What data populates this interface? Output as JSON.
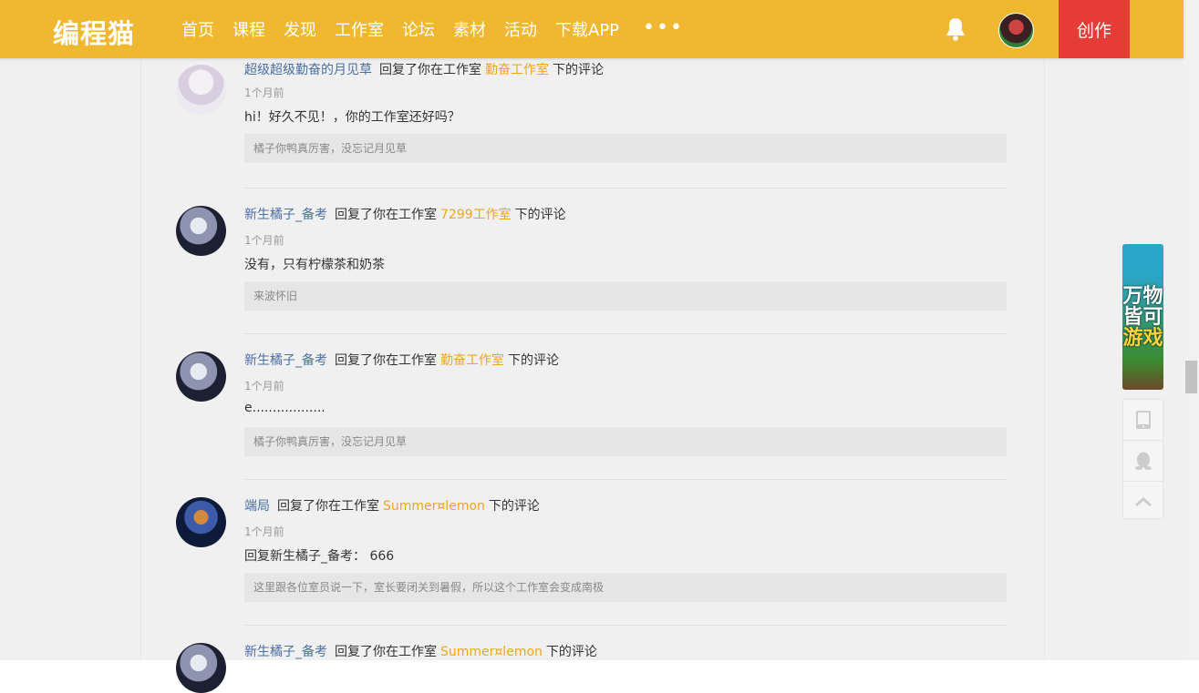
{
  "header": {
    "logo": "编程猫",
    "nav": [
      "首页",
      "课程",
      "发现",
      "工作室",
      "论坛",
      "素材",
      "活动",
      "下载APP"
    ],
    "more": "•••",
    "create_label": "创作"
  },
  "comments": [
    {
      "user": "超级超级勤奋的月见草",
      "action": "回复了你在工作室",
      "studio": "勤奋工作室",
      "suffix": "下的评论",
      "time": "1个月前",
      "text": "hi！好久不见！，你的工作室还好吗？",
      "quote": "橘子你鸭真厉害，没忘记月见草"
    },
    {
      "user": "新生橘子_备考",
      "action": "回复了你在工作室",
      "studio": "7299工作室",
      "suffix": "下的评论",
      "time": "1个月前",
      "text": "没有，只有柠檬茶和奶茶",
      "quote": "来波怀旧"
    },
    {
      "user": "新生橘子_备考",
      "action": "回复了你在工作室",
      "studio": "勤奋工作室",
      "suffix": "下的评论",
      "time": "1个月前",
      "text": "e..................",
      "quote": "橘子你鸭真厉害，没忘记月见草"
    },
    {
      "user": "端局",
      "action": "回复了你在工作室",
      "studio": "Summer¤lemon",
      "suffix": "下的评论",
      "time": "1个月前",
      "text": "回复新生橘子_备考：  666",
      "quote": "这里跟各位室员说一下，室长要闭关到暑假，所以这个工作室会变成南极"
    },
    {
      "user": "新生橘子_备考",
      "action": "回复了你在工作室",
      "studio": "Summer¤lemon",
      "suffix": "下的评论"
    }
  ],
  "promo": {
    "line1": "万物",
    "line2": "皆可",
    "line3": "游戏"
  },
  "colors": {
    "header_bg": "#efb830",
    "create_bg": "#e53c35",
    "username": "#4a6fa5",
    "studio_link": "#efa520"
  },
  "icons": [
    "bell-icon",
    "tablet-icon",
    "qq-icon",
    "back-to-top-icon"
  ]
}
